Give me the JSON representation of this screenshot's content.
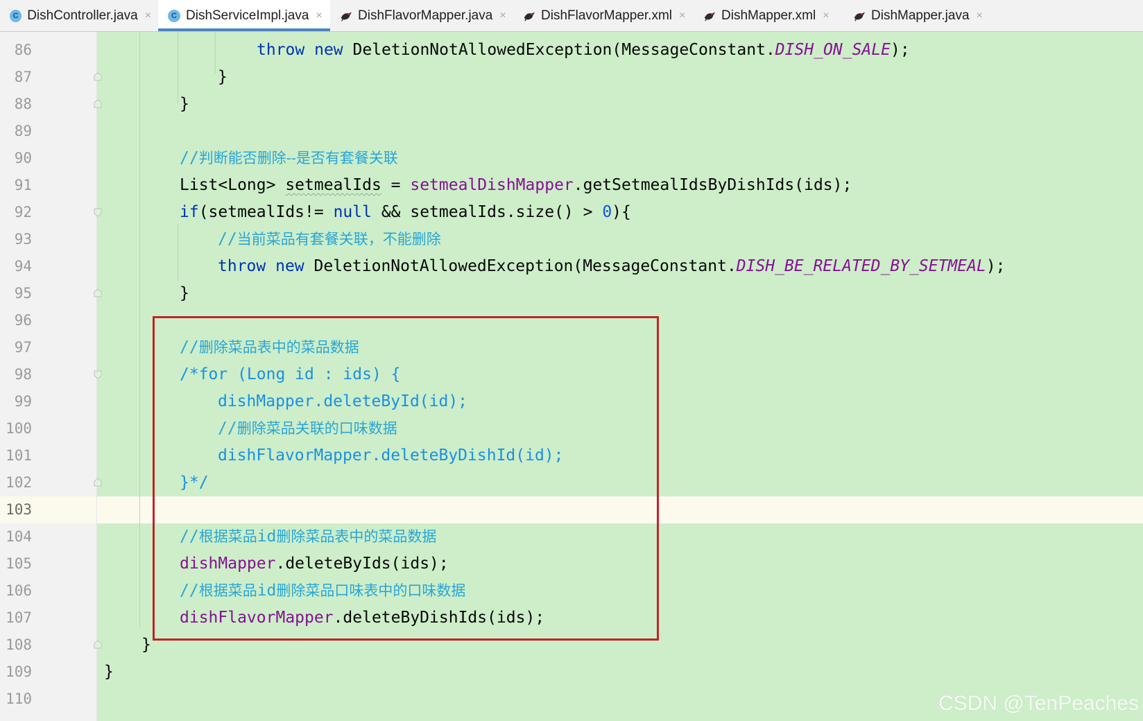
{
  "tabs": [
    {
      "label": "DishController.java",
      "icon": "java-class-icon",
      "active": false
    },
    {
      "label": "DishServiceImpl.java",
      "icon": "java-class-icon",
      "active": true
    },
    {
      "label": "DishFlavorMapper.java",
      "icon": "mybatis-bird-icon",
      "active": false
    },
    {
      "label": "DishFlavorMapper.xml",
      "icon": "mybatis-bird-icon",
      "active": false
    },
    {
      "label": "DishMapper.xml",
      "icon": "mybatis-bird-icon",
      "active": false
    },
    {
      "label": "DishMapper.java",
      "icon": "mybatis-bird-icon",
      "active": false
    }
  ],
  "tab_close_glyph": "×",
  "class_icon_letter": "C",
  "editor": {
    "current_line": "103",
    "line_numbers": [
      "86",
      "87",
      "88",
      "89",
      "90",
      "91",
      "92",
      "93",
      "94",
      "95",
      "96",
      "97",
      "98",
      "99",
      "100",
      "101",
      "102",
      "103",
      "104",
      "105",
      "106",
      "107",
      "108",
      "109",
      "110"
    ],
    "code": {
      "l86": {
        "kw1": "throw",
        "kw2": "new",
        "text": "DeletionNotAllowedException(MessageConstant.",
        "const": "DISH_ON_SALE",
        "tail": ");"
      },
      "l87": "}",
      "l88": "}",
      "l90": {
        "slash": "//",
        "text": "判断能否删除--是否有套餐关联"
      },
      "l91": {
        "a": "List<Long> ",
        "var": "setmealIds",
        "b": " = ",
        "field": "setmealDishMapper",
        "c": ".getSetmealIdsByDishIds(ids);"
      },
      "l92": {
        "kw1": "if",
        "a": "(setmealIds!= ",
        "kw2": "null",
        "b": " && setmealIds.size() > ",
        "num": "0",
        "c": "){"
      },
      "l93": {
        "slash": "//",
        "text": "当前菜品有套餐关联，不能删除"
      },
      "l94": {
        "kw1": "throw",
        "kw2": "new",
        "text": "DeletionNotAllowedException(MessageConstant.",
        "const": "DISH_BE_RELATED_BY_SETMEAL",
        "tail": ");"
      },
      "l95": "}",
      "l97": {
        "slash": "//",
        "text": "删除菜品表中的菜品数据"
      },
      "l98": "/*for (Long id : ids) {",
      "l99": "dishMapper.deleteById(id);",
      "l100": {
        "slash": "//",
        "text": "删除菜品关联的口味数据"
      },
      "l101": "dishFlavorMapper.deleteByDishId(id);",
      "l102": "}*/",
      "l104": {
        "slash": "//",
        "text": "根据菜品",
        "id": "id",
        "text2": "删除菜品表中的菜品数据"
      },
      "l105": {
        "field": "dishMapper",
        "rest": ".deleteByIds(ids);"
      },
      "l106": {
        "slash": "//",
        "text": "根据菜品",
        "id": "id",
        "text2": "删除菜品口味表中的口味数据"
      },
      "l107": {
        "field": "dishFlavorMapper",
        "rest": ".deleteByDishIds(ids);"
      },
      "l108": "}",
      "l109": "}"
    }
  },
  "watermark": "CSDN @TenPeaches",
  "colors": {
    "editor_bg": "#cdeec9",
    "current_line_bg": "#fcfaed",
    "keyword": "#0033b3",
    "field": "#871094",
    "comment": "#2aa5d6",
    "highlight_box": "#c4222a"
  }
}
